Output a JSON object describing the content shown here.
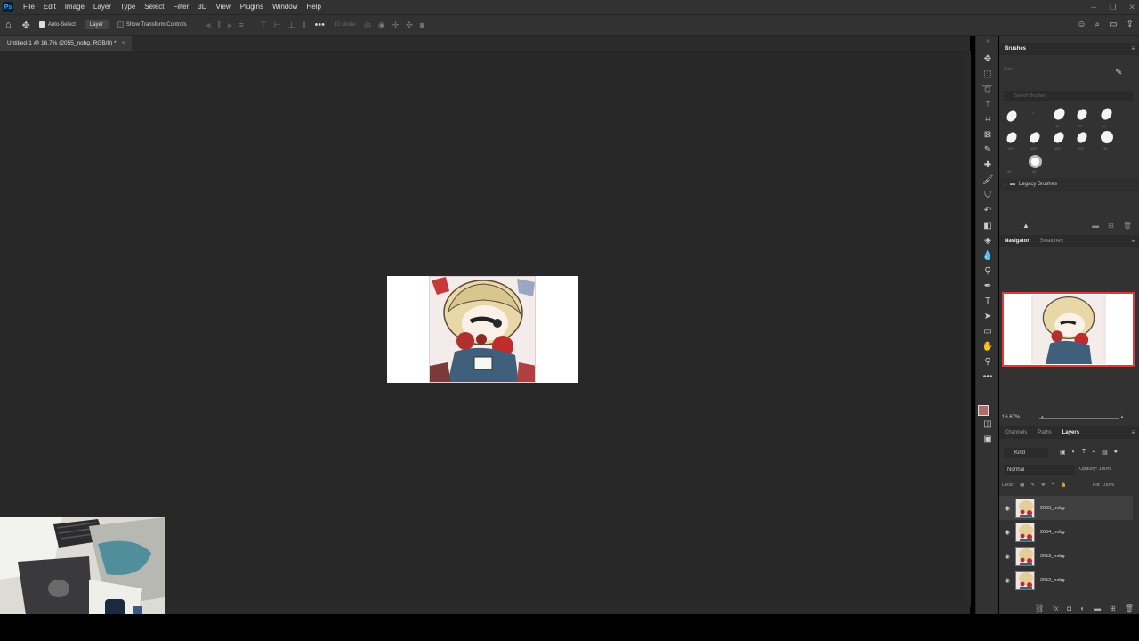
{
  "menubar": {
    "logo": "Ps",
    "items": [
      "File",
      "Edit",
      "Image",
      "Layer",
      "Type",
      "Select",
      "Filter",
      "3D",
      "View",
      "Plugins",
      "Window",
      "Help"
    ]
  },
  "options": {
    "auto_select_label": "Auto-Select",
    "target_value": "Layer",
    "transform_label": "Show Transform Controls",
    "mode_3d": "3D Mode:"
  },
  "document": {
    "tab_title": "Untitled-1 @ 16.7% (2055_nobg, RGB/8) *"
  },
  "brushes": {
    "tab": "Brushes",
    "size_label": "Size:",
    "search_placeholder": "Search Brushes",
    "folder": "Legacy Brushes",
    "numbers": [
      "1",
      "40",
      "20",
      "80",
      "100",
      "400",
      "150",
      "200",
      "30",
      "45",
      "45"
    ]
  },
  "navigator": {
    "tabs": [
      "Navigator",
      "Swatches"
    ],
    "zoom": "16.67%"
  },
  "layers": {
    "tabs": [
      "Channels",
      "Paths",
      "Layers"
    ],
    "filter_kind": "Kind",
    "blend_mode": "Normal",
    "opacity_label": "Opacity:",
    "opacity_value": "100%",
    "lock_label": "Lock:",
    "fill_label": "Fill:",
    "fill_value": "100%",
    "items": [
      {
        "name": "2055_nobg"
      },
      {
        "name": "2054_nobg"
      },
      {
        "name": "2053_nobg"
      },
      {
        "name": "2052_nobg"
      }
    ]
  },
  "colors": {
    "foreground": "#b06b6b",
    "background": "#ffffff",
    "accent": "#31a8ff"
  }
}
